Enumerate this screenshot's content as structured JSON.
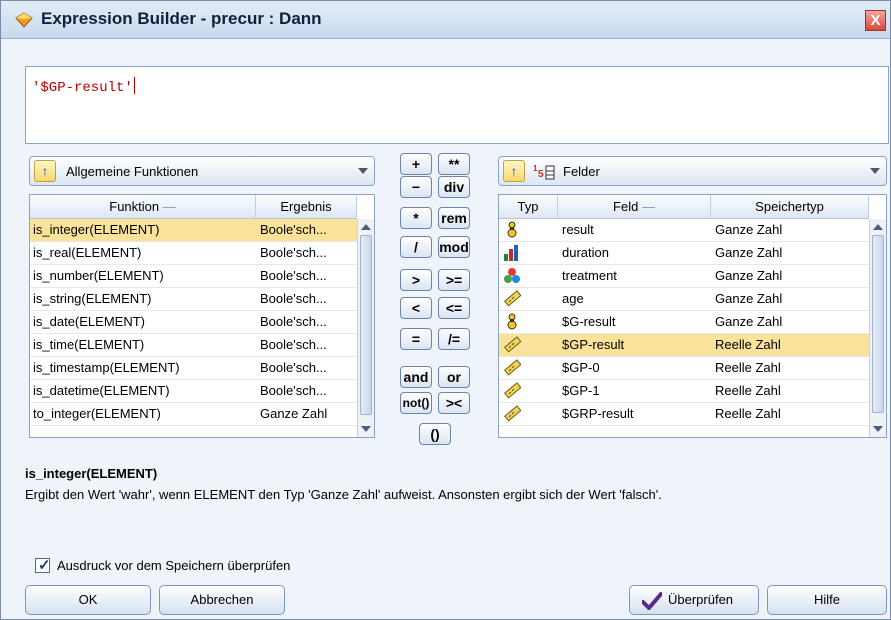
{
  "window": {
    "title": "Expression Builder - precur : Dann",
    "close_glyph": "X"
  },
  "expression": {
    "text": "'$GP-result'"
  },
  "functions": {
    "category": "Allgemeine Funktionen",
    "columns": [
      "Funktion",
      "Ergebnis"
    ],
    "rows": [
      {
        "name": "is_integer(ELEMENT)",
        "result": "Boole'sch..."
      },
      {
        "name": "is_real(ELEMENT)",
        "result": "Boole'sch..."
      },
      {
        "name": "is_number(ELEMENT)",
        "result": "Boole'sch..."
      },
      {
        "name": "is_string(ELEMENT)",
        "result": "Boole'sch..."
      },
      {
        "name": "is_date(ELEMENT)",
        "result": "Boole'sch..."
      },
      {
        "name": "is_time(ELEMENT)",
        "result": "Boole'sch..."
      },
      {
        "name": "is_timestamp(ELEMENT)",
        "result": "Boole'sch..."
      },
      {
        "name": "is_datetime(ELEMENT)",
        "result": "Boole'sch..."
      },
      {
        "name": "to_integer(ELEMENT)",
        "result": "Ganze Zahl"
      }
    ]
  },
  "operators": [
    "+",
    "**",
    "−",
    "div",
    "*",
    "rem",
    "/",
    "mod",
    ">",
    ">=",
    "<",
    "<=",
    "=",
    "/=",
    "and",
    "or",
    "not()",
    "><",
    "()"
  ],
  "fields": {
    "category": "Felder",
    "columns": [
      "Typ",
      "Feld",
      "Speichertyp"
    ],
    "rows": [
      {
        "icon": "flag-icon",
        "name": "result",
        "storage": "Ganze Zahl"
      },
      {
        "icon": "continuous-icon",
        "name": "duration",
        "storage": "Ganze Zahl"
      },
      {
        "icon": "set-icon",
        "name": "treatment",
        "storage": "Ganze Zahl"
      },
      {
        "icon": "range-icon",
        "name": "age",
        "storage": "Ganze Zahl"
      },
      {
        "icon": "flag-icon",
        "name": "$G-result",
        "storage": "Ganze Zahl"
      },
      {
        "icon": "range-icon",
        "name": "$GP-result",
        "storage": "Reelle Zahl"
      },
      {
        "icon": "range-icon",
        "name": "$GP-0",
        "storage": "Reelle Zahl"
      },
      {
        "icon": "range-icon",
        "name": "$GP-1",
        "storage": "Reelle Zahl"
      },
      {
        "icon": "range-icon",
        "name": "$GRP-result",
        "storage": "Reelle Zahl"
      }
    ]
  },
  "description": {
    "title": "is_integer(ELEMENT)",
    "text": "Ergibt den Wert 'wahr', wenn ELEMENT den Typ 'Ganze Zahl' aufweist. Ansonsten ergibt sich der Wert 'falsch'."
  },
  "validate_checkbox": {
    "label": "Ausdruck vor dem Speichern überprüfen",
    "checked": true
  },
  "buttons": {
    "ok": "OK",
    "cancel": "Abbrechen",
    "check": "Überprüfen",
    "help": "Hilfe"
  },
  "colors": {
    "selected_row": "#fbe29a",
    "expression_text": "#c00000"
  }
}
